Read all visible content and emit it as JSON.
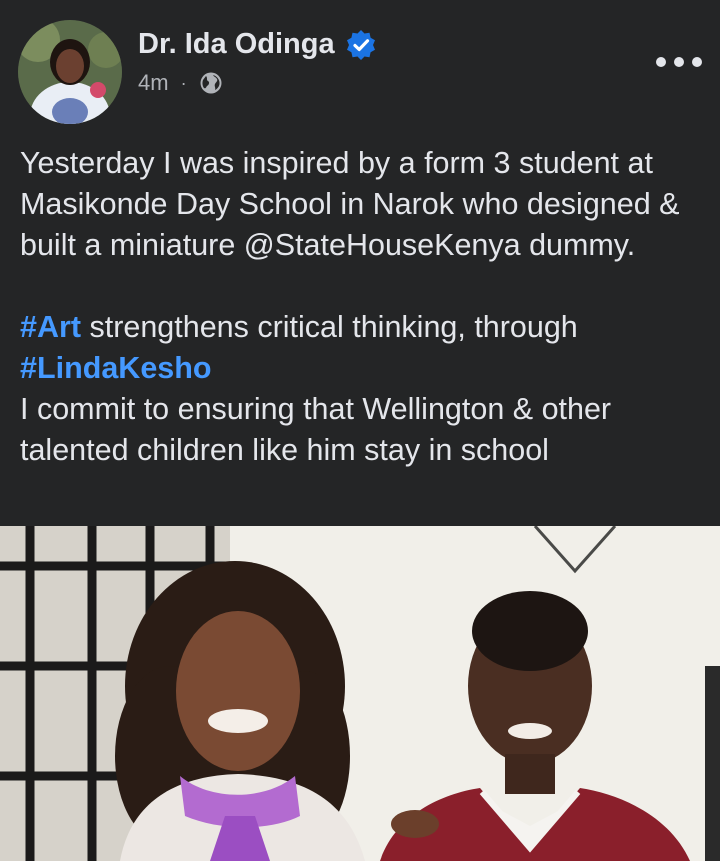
{
  "post": {
    "author": "Dr. Ida Odinga",
    "time": "4m",
    "separator": "·",
    "audience_icon": "globe-icon",
    "verified_icon": "verified-badge-icon",
    "more_icon": "more-options-icon",
    "paragraph1": "Yesterday I was inspired by a form 3 student at Masikonde Day School in Narok who designed & built a miniature @StateHouseKenya dummy.",
    "paragraph2_hashtag1": "#Art",
    "paragraph2_text": " strengthens critical thinking, through",
    "paragraph2_hashtag2": "#LindaKesho",
    "paragraph3": "I commit to ensuring that Wellington & other talented children like him stay in school"
  },
  "colors": {
    "background": "#242526",
    "text": "#e4e6eb",
    "secondary_text": "#b0b3b8",
    "hashtag": "#4599ff",
    "verified": "#1b74e4"
  }
}
